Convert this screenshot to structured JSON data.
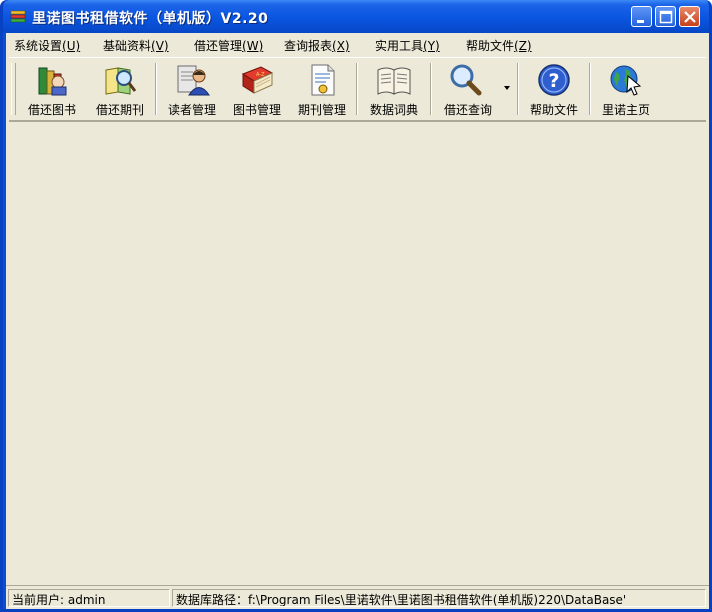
{
  "window": {
    "title": "里诺图书租借软件（单机版）V2.20",
    "controls": {
      "minimize": "minimize",
      "maximize": "maximize",
      "close": "close"
    }
  },
  "menubar": {
    "items": [
      {
        "label": "系统设置",
        "shortcut": "(U)"
      },
      {
        "label": "基础资料",
        "shortcut": "(V)"
      },
      {
        "label": "借还管理",
        "shortcut": "(W)"
      },
      {
        "label": "查询报表",
        "shortcut": "(X)"
      },
      {
        "label": "实用工具",
        "shortcut": "(Y)"
      },
      {
        "label": "帮助文件",
        "shortcut": "(Z)"
      }
    ]
  },
  "toolbar": {
    "buttons": [
      {
        "label": "借还图书",
        "icon": "book-stack-icon"
      },
      {
        "label": "借还期刊",
        "icon": "magazine-magnifier-icon"
      },
      {
        "label": "读者管理",
        "icon": "reader-person-icon"
      },
      {
        "label": "图书管理",
        "icon": "red-book-icon"
      },
      {
        "label": "期刊管理",
        "icon": "document-icon"
      },
      {
        "label": "数据词典",
        "icon": "open-book-icon"
      },
      {
        "label": "借还查询",
        "icon": "magnifier-icon"
      },
      {
        "label": "帮助文件",
        "icon": "help-icon"
      },
      {
        "label": "里诺主页",
        "icon": "globe-cursor-icon"
      }
    ]
  },
  "statusbar": {
    "user": "当前用户: admin",
    "db_path": "数据库路径：f:\\Program Files\\里诺软件\\里诺图书租借软件(单机版)220\\DataBase'"
  },
  "colors": {
    "title_bar": "#0a55e0",
    "face": "#ece9d8",
    "close_button": "#d54a24"
  }
}
